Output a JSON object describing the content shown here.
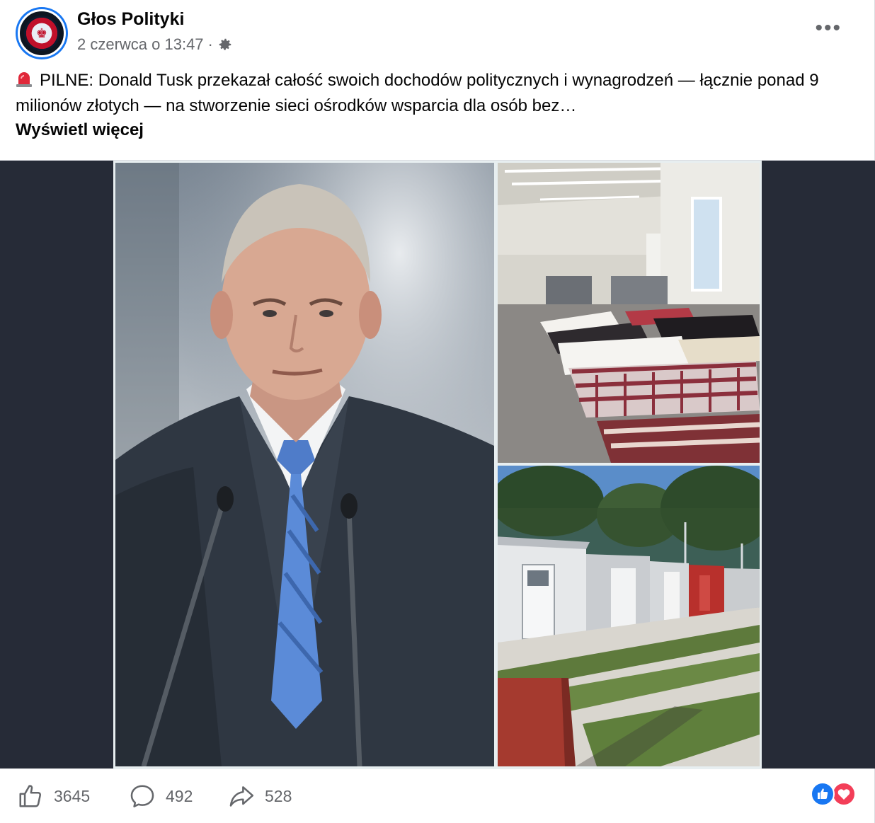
{
  "post": {
    "page_name": "Głos Polityki",
    "date": "2 czerwca o 13:47",
    "separator": "·",
    "text": "PILNE: Donald Tusk przekazał całość swoich dochodów politycznych i wynagrodzeń — łącznie ponad 9 milionów złotych — na stworzenie sieci ośrodków wsparcia dla osób bez…",
    "see_more": "Wyświetl więcej"
  },
  "stats": {
    "likes": "3645",
    "comments": "492",
    "shares": "528"
  },
  "icons": {
    "siren": "siren-icon",
    "privacy": "gear-icon",
    "more": "more-options-icon",
    "like": "like-icon",
    "comment": "comment-icon",
    "share": "share-icon",
    "reactions": [
      "like-reaction-icon",
      "love-reaction-icon"
    ]
  },
  "colors": {
    "accent": "#1877f2",
    "love": "#f33e58",
    "secondary_text": "#65676b",
    "media_bg": "#262b37"
  }
}
